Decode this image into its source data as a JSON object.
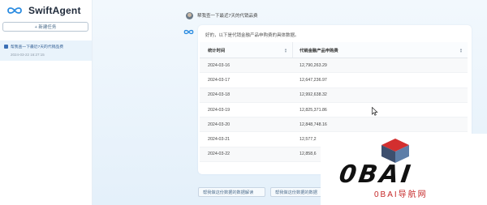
{
  "app": {
    "name": "SwiftAgent"
  },
  "sidebar": {
    "new_task_label": "+ 新建任务",
    "history": [
      {
        "title": "帮我查一下最近7天的代销品费",
        "time": "2024-03-22 16:27:15"
      }
    ]
  },
  "chat": {
    "user_message": "帮我查一下最近7天的代销品费",
    "assistant_intro": "好的，以下是代销金融产品申购费的具体数据。"
  },
  "table": {
    "columns": [
      "统计时间",
      "代销金融产品申购费"
    ],
    "rows": [
      [
        "2024-03-16",
        "12,790,263.29"
      ],
      [
        "2024-03-17",
        "12,647,236.97"
      ],
      [
        "2024-03-18",
        "12,992,638.32"
      ],
      [
        "2024-03-19",
        "12,825,371.86"
      ],
      [
        "2024-03-20",
        "12,848,748.16"
      ],
      [
        "2024-03-21",
        "12,577,2"
      ],
      [
        "2024-03-22",
        "12,858,6"
      ]
    ]
  },
  "suggestions": [
    "帮我做这份数据的数据解读",
    "帮我做这份数据的数据"
  ],
  "watermark": {
    "big": "0BAI",
    "small": "0BAI导航网"
  },
  "colors": {
    "accent": "#3b6fb5",
    "logo_blue": "#2a8be0",
    "watermark_red": "#c62828"
  }
}
